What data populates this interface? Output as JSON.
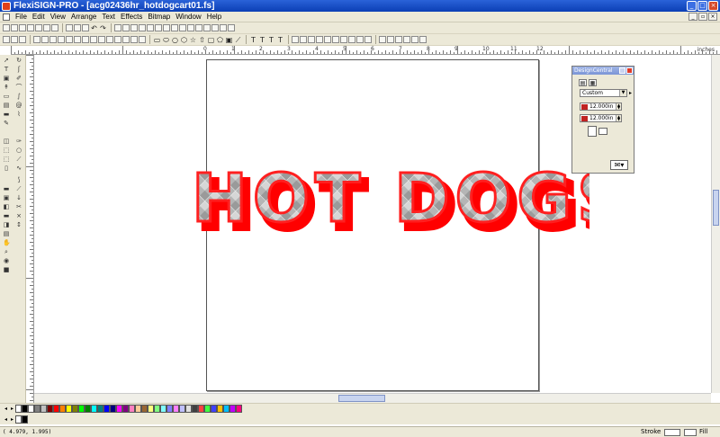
{
  "window": {
    "title": "FlexiSIGN-PRO - [acg02436hr_hotdogcart01.fs]"
  },
  "menu": [
    "File",
    "Edit",
    "View",
    "Arrange",
    "Text",
    "Effects",
    "Bitmap",
    "Window",
    "Help"
  ],
  "ruler": {
    "unit": "inches",
    "labels": [
      "0",
      "1",
      "2",
      "3",
      "4",
      "5",
      "6",
      "7",
      "8",
      "9",
      "10",
      "11",
      "12"
    ]
  },
  "canvas": {
    "artwork_text": "HOT DOGS"
  },
  "design_central": {
    "title": "DesignCentral",
    "preset": "Custom",
    "width": "12.000in",
    "height": "12.000in"
  },
  "palette": {
    "row1": [
      "#000000",
      "#ffffff",
      "#808080",
      "#c0c0c0",
      "#800000",
      "#ff0000",
      "#ff8000",
      "#ffff00",
      "#808000",
      "#00ff00",
      "#008000",
      "#00ffff",
      "#008080",
      "#0000ff",
      "#000080",
      "#ff00ff",
      "#800080",
      "#ff80c0",
      "#ffcc99",
      "#996633",
      "#ffff80",
      "#80ff80",
      "#80ffff",
      "#8080ff",
      "#ff80ff",
      "#c0c0ff",
      "#e0e0e0",
      "#404040",
      "#ff4040",
      "#40ff40",
      "#4040ff",
      "#ffc000",
      "#00c0ff",
      "#c000ff",
      "#ff0080"
    ],
    "row2": [
      "#ffffff",
      "#000000"
    ]
  },
  "status": {
    "coordinates": "( 4.979, 1.995)",
    "stroke_label": "Stroke",
    "fill_label": "Fill"
  },
  "colors": {
    "title_bar": "#0b3fb5",
    "shadow_red": "#ff0000",
    "outline_red": "#ff2020",
    "face_gray": "#b8b8b8"
  }
}
